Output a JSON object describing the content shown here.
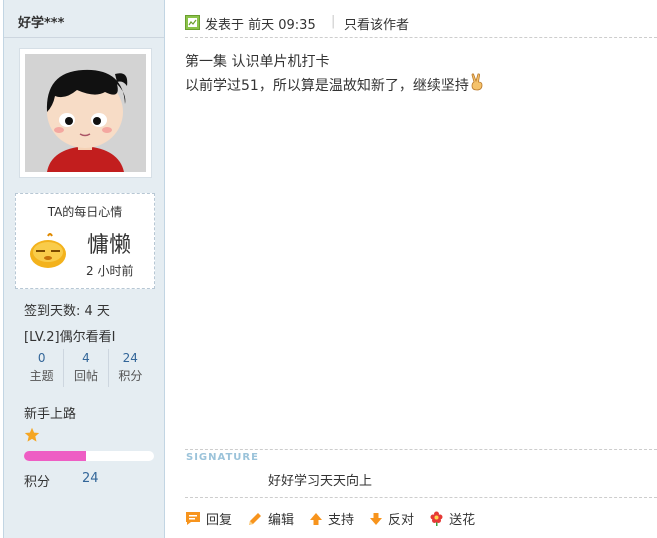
{
  "author": {
    "username": "好学***",
    "mood_title": "TA的每日心情",
    "mood": "慵懒",
    "mood_time": "2 小时前",
    "signin": "签到天数: 4 天",
    "level": "[LV.2]偶尔看看I",
    "stats": [
      {
        "num": "0",
        "label": "主题"
      },
      {
        "num": "4",
        "label": "回帖"
      },
      {
        "num": "24",
        "label": "积分"
      }
    ],
    "group": "新手上路",
    "stars": 1,
    "progress": 0.48,
    "score_label": "积分",
    "score_value": "24"
  },
  "post": {
    "time": "发表于 前天 09:35",
    "separator": "|",
    "only_author": "只看该作者",
    "line1": "第一集 认识单片机打卡",
    "line2": "以前学过51，所以算是温故知新了，继续坚持",
    "signature_label": "SIGNATURE",
    "signature": "好好学习天天向上"
  },
  "actions": {
    "reply": "回复",
    "edit": "编辑",
    "support": "支持",
    "oppose": "反对",
    "flower": "送花"
  },
  "colors": {
    "sidebar_bg": "#e5edf2",
    "link": "#336699",
    "progress": "#ee5ec4",
    "signature_label": "#9bc3da"
  }
}
